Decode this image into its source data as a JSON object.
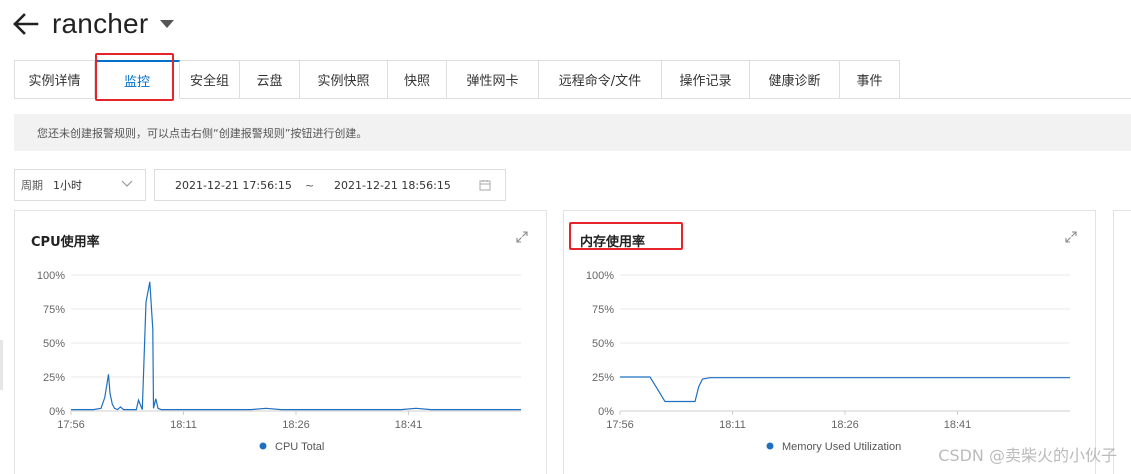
{
  "header": {
    "title": "rancher"
  },
  "tabs": [
    {
      "label": "实例详情"
    },
    {
      "label": "监控"
    },
    {
      "label": "安全组"
    },
    {
      "label": "云盘"
    },
    {
      "label": "实例快照"
    },
    {
      "label": "快照"
    },
    {
      "label": "弹性网卡"
    },
    {
      "label": "远程命令/文件"
    },
    {
      "label": "操作记录"
    },
    {
      "label": "健康诊断"
    },
    {
      "label": "事件"
    }
  ],
  "active_tab": "监控",
  "notice": {
    "text": "您还未创建报警规则，可以点击右侧“创建报警规则”按钮进行创建。"
  },
  "period": {
    "label": "周期",
    "value": "1小时"
  },
  "daterange": {
    "start": "2021-12-21 17:56:15",
    "separator": "~",
    "end": "2021-12-21 18:56:15"
  },
  "colors": {
    "accent": "#0070cc",
    "series": "#1f6fc1",
    "highlight": "#e4262b"
  },
  "chart_data": [
    {
      "type": "line",
      "title": "CPU使用率",
      "ylim": [
        0,
        100
      ],
      "yticks": [
        "0%",
        "25%",
        "50%",
        "75%",
        "100%"
      ],
      "xticks": [
        "17:56",
        "18:11",
        "18:26",
        "18:41"
      ],
      "x": [
        0,
        3,
        4,
        4.5,
        5,
        5.2,
        5.5,
        5.8,
        6.2,
        6.6,
        7,
        7.5,
        8,
        8.7,
        9,
        9.5,
        10,
        10.5,
        10.9,
        11,
        11.3,
        11.6,
        12,
        12.5,
        13,
        13.5,
        14,
        15,
        16,
        17,
        18,
        20,
        22,
        24,
        26,
        28,
        30,
        32,
        34,
        36,
        38,
        40,
        42,
        44,
        46,
        48,
        50,
        52,
        54,
        56,
        58,
        60
      ],
      "series": [
        {
          "name": "CPU Total",
          "values": [
            1,
            1,
            2,
            10,
            27,
            13,
            5,
            2,
            1,
            3,
            1,
            1,
            1,
            1,
            8,
            1,
            80,
            95,
            60,
            2,
            9,
            2,
            1,
            1,
            1,
            1,
            1,
            1,
            1,
            1,
            1,
            1,
            1,
            1,
            2,
            1,
            1,
            1,
            1,
            1,
            1,
            1,
            1,
            1,
            2,
            1,
            1,
            1,
            1,
            1,
            1,
            1
          ]
        }
      ],
      "legend": "bottom"
    },
    {
      "type": "line",
      "title": "内存使用率",
      "ylim": [
        0,
        100
      ],
      "yticks": [
        "0%",
        "25%",
        "50%",
        "75%",
        "100%"
      ],
      "xticks": [
        "17:56",
        "18:11",
        "18:26",
        "18:41"
      ],
      "x": [
        0,
        4,
        5,
        6,
        8,
        10,
        10.5,
        11,
        12,
        20,
        30,
        40,
        50,
        60
      ],
      "series": [
        {
          "name": "Memory Used Utilization",
          "values": [
            25,
            25,
            16,
            7,
            7,
            7,
            18,
            23.5,
            24.5,
            24.5,
            24.5,
            24.5,
            24.5,
            24.5
          ]
        }
      ],
      "legend": "bottom"
    }
  ],
  "watermark": "CSDN @卖柴火的小伙子"
}
